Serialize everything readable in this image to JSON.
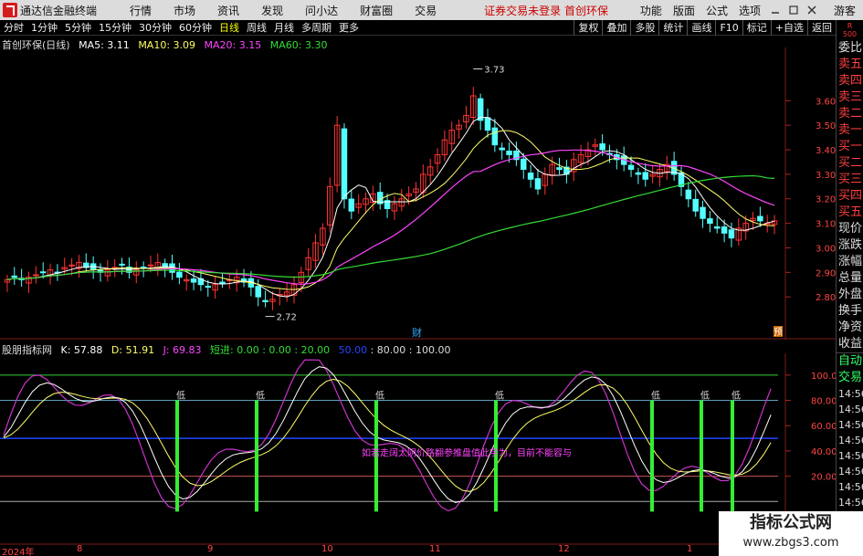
{
  "menubar": {
    "app_title": "通达信金融终端",
    "items": [
      "行情",
      "市场",
      "资讯",
      "发现",
      "问小达",
      "财富圈",
      "交易"
    ],
    "notice": "证券交易未登录  首创环保",
    "right_items": [
      "功能",
      "版面",
      "公式",
      "选项"
    ],
    "guest": "游客"
  },
  "toolbar": {
    "periods": [
      "分时",
      "1分钟",
      "5分钟",
      "15分钟",
      "30分钟",
      "60分钟",
      "日线",
      "周线",
      "月线",
      "多周期",
      "更多"
    ],
    "active_period": "日线",
    "right_tools": [
      "复权",
      "叠加",
      "多股",
      "统计",
      "画线",
      "F10",
      "标记",
      "+自选",
      "返回"
    ]
  },
  "main_info": {
    "stock": "首创环保(日线)",
    "ma5": "MA5: 3.11",
    "ma10": "MA10: 3.09",
    "ma20": "MA20: 3.15",
    "ma60": "MA60: 3.30",
    "colors": {
      "ma5": "#ffffff",
      "ma10": "#ffff66",
      "ma20": "#ff44ff",
      "ma60": "#33dd33"
    }
  },
  "sub_info": {
    "indicator": "股朋指标网",
    "k": "K: 57.88",
    "d": "D: 51.91",
    "j": "J: 69.83",
    "entry": "短进: 0.00 : 0.00 : 20.00",
    "levels_blue": "50.00",
    "levels_white": ": 80.00 : 100.00"
  },
  "main_axis": [
    "3.60",
    "3.50",
    "3.40",
    "3.30",
    "3.20",
    "3.10",
    "3.00",
    "2.90",
    "2.80"
  ],
  "sub_axis": [
    "100.0",
    "80.00",
    "60.00",
    "40.00",
    "20.00"
  ],
  "annotations": {
    "high": "3.73",
    "low": "2.72",
    "cai": "财",
    "yu": "预",
    "low_tag": "低",
    "overlay_text": "如若走阔太阴价路翻参推盘值此字为，目前不能容与"
  },
  "date_labels": [
    "2024年",
    "8",
    "9",
    "10",
    "11",
    "12",
    "1"
  ],
  "right_strip": {
    "top": [
      "R",
      "500"
    ],
    "items": [
      "委比",
      "卖五",
      "卖四",
      "卖三",
      "卖二",
      "卖一",
      "买一",
      "买二",
      "买三",
      "买四",
      "买五",
      "现价",
      "涨跌",
      "涨幅",
      "总量",
      "外盘",
      "换手",
      "净资",
      "收益"
    ],
    "lower": [
      "自动",
      "交易"
    ],
    "times": [
      "14:56",
      "14:56",
      "14:56",
      "14:56",
      "14:56",
      "14:56",
      "14:56",
      "14:56",
      "14:56",
      "14:56"
    ]
  },
  "watermark": {
    "line1": "指标公式网",
    "line2": "www.zbgs3.com"
  },
  "chart_data": {
    "type": "line",
    "candles_close": [
      2.87,
      2.88,
      2.87,
      2.88,
      2.89,
      2.9,
      2.91,
      2.9,
      2.92,
      2.93,
      2.94,
      2.92,
      2.91,
      2.9,
      2.91,
      2.92,
      2.93,
      2.9,
      2.91,
      2.92,
      2.93,
      2.94,
      2.92,
      2.9,
      2.88,
      2.87,
      2.86,
      2.85,
      2.84,
      2.85,
      2.86,
      2.87,
      2.88,
      2.86,
      2.84,
      2.8,
      2.78,
      2.79,
      2.81,
      2.82,
      2.85,
      2.9,
      2.96,
      3.02,
      3.08,
      3.25,
      3.5,
      3.2,
      3.15,
      3.18,
      3.2,
      3.22,
      3.18,
      3.16,
      3.18,
      3.2,
      3.22,
      3.24,
      3.3,
      3.33,
      3.38,
      3.44,
      3.48,
      3.5,
      3.54,
      3.62,
      3.52,
      3.48,
      3.42,
      3.4,
      3.38,
      3.36,
      3.32,
      3.28,
      3.24,
      3.3,
      3.34,
      3.32,
      3.3,
      3.36,
      3.38,
      3.4,
      3.42,
      3.4,
      3.38,
      3.36,
      3.34,
      3.32,
      3.3,
      3.28,
      3.3,
      3.32,
      3.34,
      3.3,
      3.25,
      3.2,
      3.15,
      3.12,
      3.1,
      3.08,
      3.06,
      3.04,
      3.08,
      3.1,
      3.12,
      3.11,
      3.1,
      3.11
    ],
    "ylim": [
      2.7,
      3.78
    ]
  }
}
